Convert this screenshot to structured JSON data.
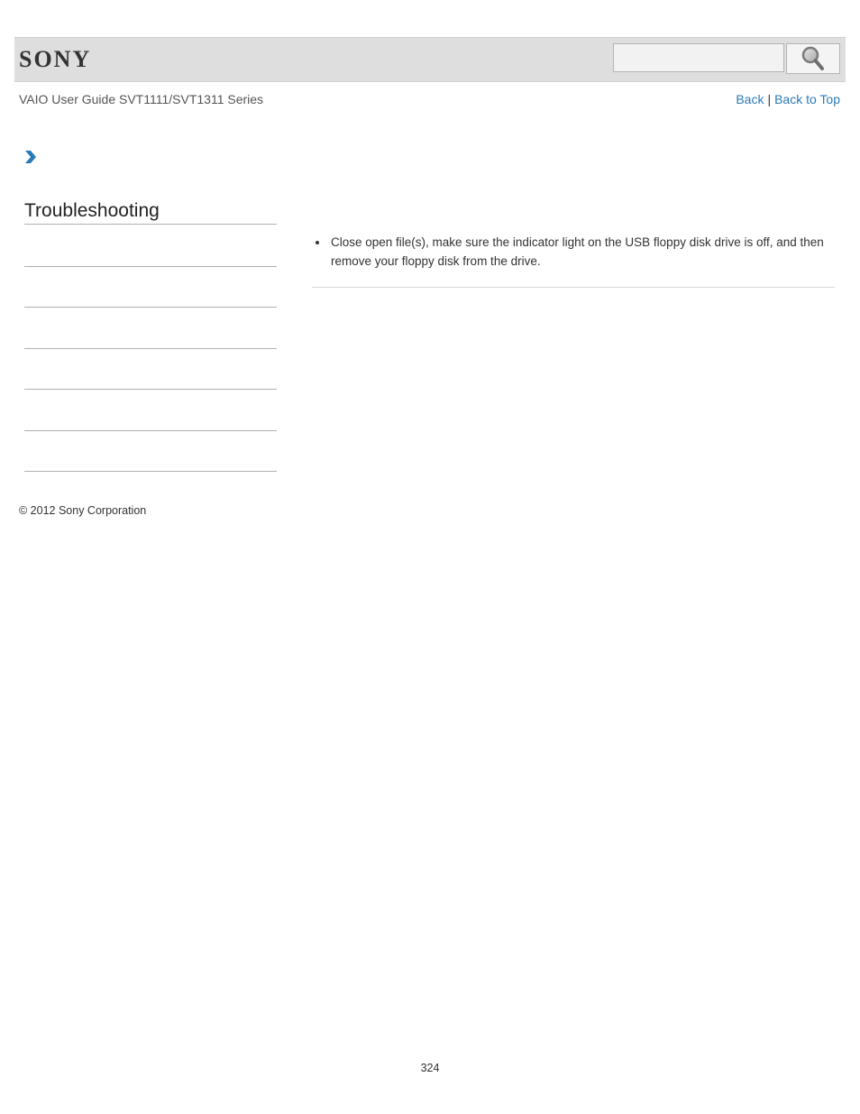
{
  "header": {
    "logo_text": "SONY",
    "search": {
      "value": "",
      "placeholder": ""
    },
    "search_icon": "magnifier-icon"
  },
  "subheader": {
    "guide_title": "VAIO User Guide SVT1111/SVT1311 Series",
    "back_label": "Back",
    "separator": "|",
    "back_to_top_label": "Back to Top"
  },
  "breadcrumb": {
    "icon": "chevron-right-icon",
    "accent_color": "#2a7ab8"
  },
  "sidebar": {
    "title": "Troubleshooting",
    "items": [
      "",
      "",
      "",
      "",
      "",
      ""
    ]
  },
  "content": {
    "bullets": [
      "Close open file(s), make sure the indicator light on the USB floppy disk drive is off, and then remove your floppy disk from the drive."
    ]
  },
  "footer": {
    "copyright": "© 2012 Sony Corporation",
    "page_number": "324"
  },
  "colors": {
    "header_bg": "#dedede",
    "link": "#2a7ab8",
    "text": "#333333"
  }
}
